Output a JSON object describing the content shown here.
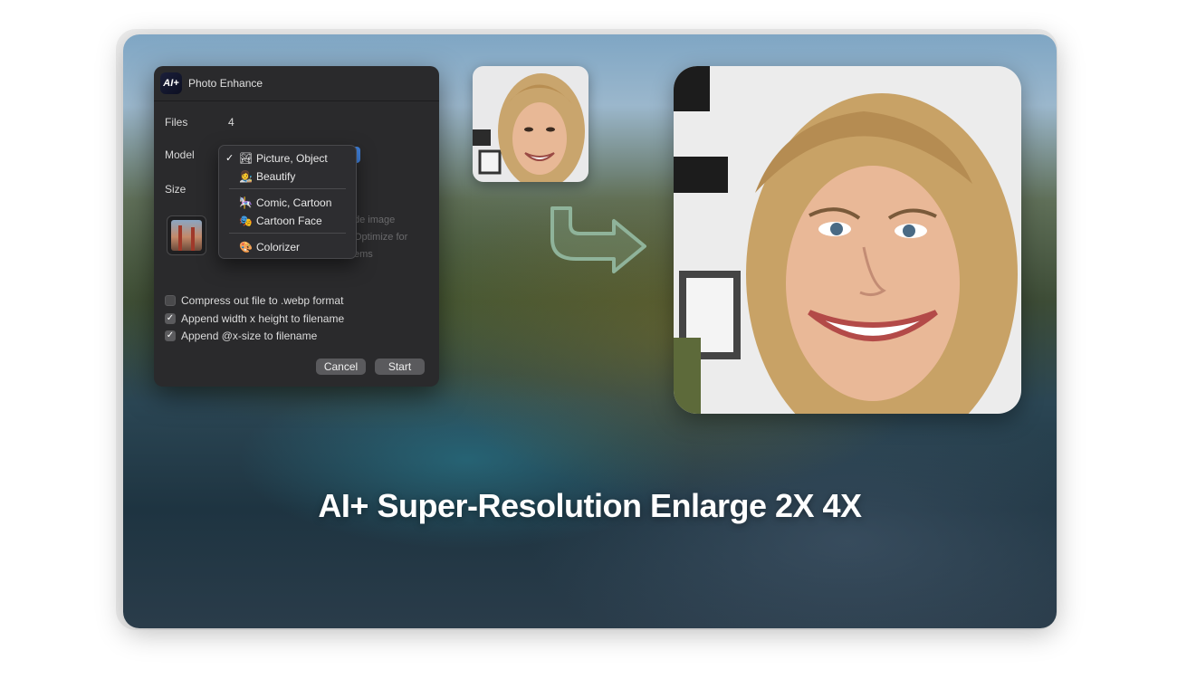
{
  "dialog": {
    "title": "Photo Enhance",
    "app_icon_text": "AI+",
    "files_label": "Files",
    "files_value": "4",
    "model_label": "Model",
    "size_label": "Size",
    "hidden_text_1": "de image",
    "hidden_text_2": "Optimize for",
    "hidden_text_3": "ems",
    "options": [
      {
        "label": "Compress out file to .webp format",
        "checked": false
      },
      {
        "label": "Append width x height to filename",
        "checked": true
      },
      {
        "label": "Append @x-size to filename",
        "checked": true
      }
    ],
    "cancel_label": "Cancel",
    "start_label": "Start"
  },
  "model_menu": {
    "items": [
      {
        "label": "Picture, Object",
        "icon": "🏞",
        "icon_name": "landscape-icon",
        "selected": true
      },
      {
        "label": "Beautify",
        "icon": "👩‍🎨",
        "icon_name": "beautify-icon",
        "selected": false
      },
      {
        "label": "Comic, Cartoon",
        "icon": "🎠",
        "icon_name": "comic-icon",
        "selected": false
      },
      {
        "label": "Cartoon Face",
        "icon": "🎭",
        "icon_name": "cartoon-face-icon",
        "selected": false
      },
      {
        "label": "Colorizer",
        "icon": "🎨",
        "icon_name": "palette-icon",
        "selected": false
      }
    ],
    "check_mark": "✓"
  },
  "headline": "AI+ Super-Resolution Enlarge 2X 4X",
  "colors": {
    "dialog_bg": "#2a2a2c",
    "accent": "#3f7fd9",
    "arrow": "#8fb39a"
  }
}
